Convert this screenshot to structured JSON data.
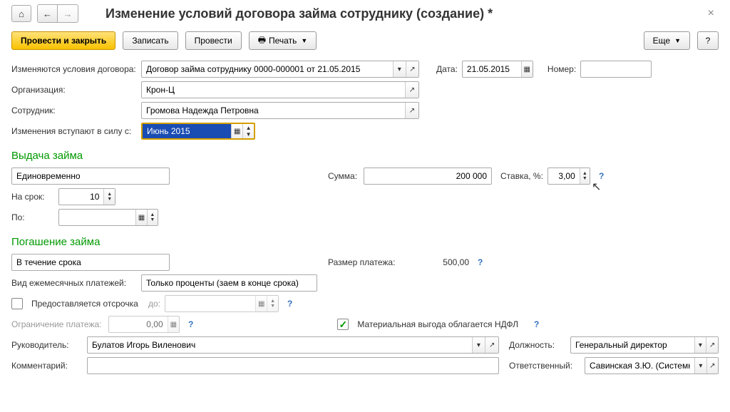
{
  "title": "Изменение условий договора займа сотруднику (создание) *",
  "cmdbar": {
    "post_close": "Провести и закрыть",
    "save": "Записать",
    "post": "Провести",
    "print": "Печать",
    "more": "Еще",
    "help": "?"
  },
  "labels": {
    "contract": "Изменяются условия договора:",
    "org": "Организация:",
    "employee": "Сотрудник:",
    "effective": "Изменения вступают в силу с:",
    "date": "Дата:",
    "number": "Номер:",
    "issue_section": "Выдача займа",
    "sum": "Сумма:",
    "rate": "Ставка, %:",
    "term": "На срок:",
    "until": "По:",
    "repay_section": "Погашение займа",
    "payment_size": "Размер платежа:",
    "payment_type": "Вид ежемесячных платежей:",
    "deferral": "Предоставляется отсрочка",
    "deferral_until": "до:",
    "limit": "Ограничение платежа:",
    "ndfl": "Материальная выгода облагается НДФЛ",
    "manager": "Руководитель:",
    "position": "Должность:",
    "comment": "Комментарий:",
    "responsible": "Ответственный:"
  },
  "values": {
    "contract": "Договор займа сотруднику 0000-000001 от 21.05.2015",
    "org": "Крон-Ц",
    "employee": "Громова Надежда Петровна",
    "effective": "Июнь 2015",
    "date": "21.05.2015",
    "number": "",
    "issue_mode": "Единовременно",
    "sum": "200 000",
    "rate": "3,00",
    "term": "10",
    "until": "",
    "repay_mode": "В течение срока",
    "payment_size": "500,00",
    "payment_type_val": "Только проценты (заем в конце срока)",
    "deferral_until": "",
    "limit": "0,00",
    "manager": "Булатов Игорь Виленович",
    "position": "Генеральный директор",
    "comment": "",
    "responsible": "Савинская З.Ю. (Системный про"
  }
}
